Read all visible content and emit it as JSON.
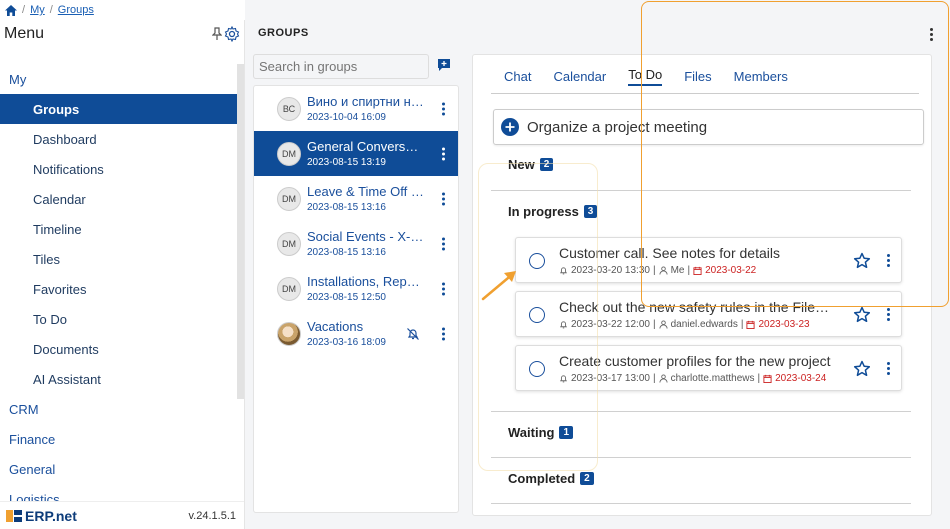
{
  "breadcrumb": {
    "home_icon": "home-icon",
    "items": [
      "My",
      "Groups"
    ]
  },
  "sidebar": {
    "title": "Menu",
    "items": [
      {
        "label": "My",
        "level": 1
      },
      {
        "label": "Groups",
        "level": 2,
        "active": true
      },
      {
        "label": "Dashboard",
        "level": 2
      },
      {
        "label": "Notifications",
        "level": 2
      },
      {
        "label": "Calendar",
        "level": 2
      },
      {
        "label": "Timeline",
        "level": 2
      },
      {
        "label": "Tiles",
        "level": 2
      },
      {
        "label": "Favorites",
        "level": 2
      },
      {
        "label": "To Do",
        "level": 2
      },
      {
        "label": "Documents",
        "level": 2
      },
      {
        "label": "AI Assistant",
        "level": 2
      },
      {
        "label": "CRM",
        "level": 1
      },
      {
        "label": "Finance",
        "level": 1
      },
      {
        "label": "General",
        "level": 1
      },
      {
        "label": "Logistics",
        "level": 1
      }
    ],
    "logo": "ERP.net",
    "version": "v.24.1.5.1"
  },
  "groups": {
    "title": "GROUPS",
    "search_placeholder": "Search in groups",
    "items": [
      {
        "initials": "ВС",
        "name": "Вино и спиртни напитки",
        "date": "2023-10-04 16:09"
      },
      {
        "initials": "DM",
        "name": "General Conversation",
        "date": "2023-08-15 13:19",
        "active": true
      },
      {
        "initials": "DM",
        "name": "Leave & Time Off - X-Team",
        "date": "2023-08-15 13:16"
      },
      {
        "initials": "DM",
        "name": "Social Events - X-Team",
        "date": "2023-08-15 13:16"
      },
      {
        "initials": "DM",
        "name": "Installations, Repairs",
        "date": "2023-08-15 12:50"
      },
      {
        "initials": "",
        "name": "Vacations",
        "date": "2023-03-16 18:09",
        "muted": true
      }
    ]
  },
  "detail": {
    "tabs": [
      "Chat",
      "Calendar",
      "To Do",
      "Files",
      "Members"
    ],
    "active_tab": "To Do",
    "new_task_placeholder": "Organize a project meeting",
    "sections": [
      {
        "label": "New",
        "count": "2"
      },
      {
        "label": "In progress",
        "count": "3"
      },
      {
        "label": "Waiting",
        "count": "1"
      },
      {
        "label": "Completed",
        "count": "2"
      }
    ],
    "tasks": [
      {
        "title": "Customer call. See notes for details",
        "reminder": "2023-03-20 13:30",
        "user": "Me",
        "due": "2023-03-22"
      },
      {
        "title": "Check out the new safety rules in the File tab",
        "reminder": "2023-03-22 12:00",
        "user": "daniel.edwards",
        "due": "2023-03-23"
      },
      {
        "title": "Create customer profiles for the new project",
        "reminder": "2023-03-17 13:00",
        "user": "charlotte.matthews",
        "due": "2023-03-24"
      }
    ]
  },
  "colors": {
    "primary": "#0f4c97",
    "accent": "#f0a030",
    "due": "#cc2222"
  }
}
